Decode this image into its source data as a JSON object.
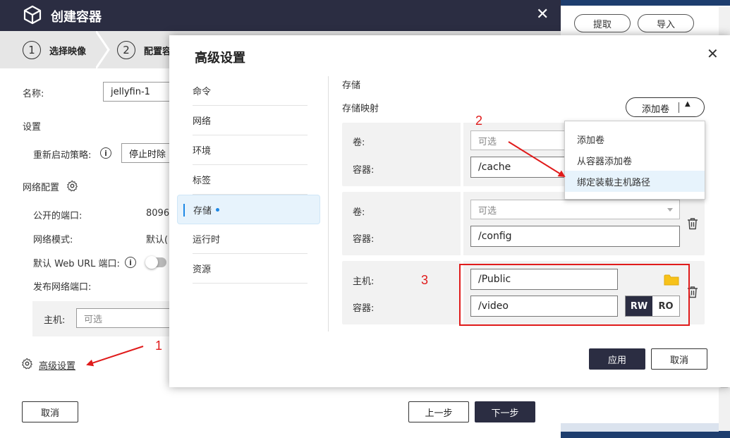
{
  "background_app": {
    "buttons": [
      {
        "label": "提取"
      },
      {
        "label": "导入"
      }
    ]
  },
  "main_dialog": {
    "title": "创建容器",
    "close_glyph": "✕",
    "steps": [
      {
        "number": "1",
        "label": "选择映像"
      },
      {
        "number": "2",
        "label": "配置容"
      }
    ],
    "fields": {
      "name_label": "名称:",
      "name_value": "jellyfin-1",
      "settings_label": "设置",
      "restart_policy_label": "重新启动策略:",
      "restart_policy_value": "停止时除",
      "network_config_label": "网络配置",
      "public_ports_label": "公开的端口:",
      "public_ports_value": "8096",
      "network_mode_label": "网络模式:",
      "network_mode_value": "默认(",
      "default_web_url_label": "默认 Web URL 端口:",
      "publish_ports_label": "发布网络端口:",
      "host_label": "主机:",
      "host_placeholder": "可选"
    },
    "advanced_link": "高级设置",
    "cancel_button": "取消",
    "prev_button": "上一步",
    "next_button": "下一步"
  },
  "advanced_dialog": {
    "title": "高级设置",
    "close_glyph": "✕",
    "nav": [
      {
        "label": "命令"
      },
      {
        "label": "网络"
      },
      {
        "label": "环境"
      },
      {
        "label": "标签"
      },
      {
        "label": "存储",
        "active": true
      },
      {
        "label": "运行时"
      },
      {
        "label": "资源"
      }
    ],
    "storage": {
      "section_title": "存储",
      "mapping_title": "存储映射",
      "add_volume_button": "添加卷",
      "add_volume_caret": "▲",
      "dropdown": [
        {
          "label": "添加卷"
        },
        {
          "label": "从容器添加卷"
        },
        {
          "label": "绑定装载主机路径",
          "highlighted": true
        }
      ],
      "cards": [
        {
          "volume_label": "卷:",
          "volume_placeholder": "可选",
          "container_label": "容器:",
          "container_value": "/cache"
        },
        {
          "volume_label": "卷:",
          "volume_placeholder": "可选",
          "container_label": "容器:",
          "container_value": "/config"
        },
        {
          "host_label": "主机:",
          "host_value": "/Public",
          "container_label": "容器:",
          "container_value": "/video",
          "mode_options": [
            "RW",
            "RO"
          ],
          "mode_selected": "RW"
        }
      ]
    },
    "apply_button": "应用",
    "cancel_button": "取消"
  },
  "annotations": {
    "one": "1",
    "two": "2",
    "three": "3",
    "color": "#e01b1b"
  }
}
